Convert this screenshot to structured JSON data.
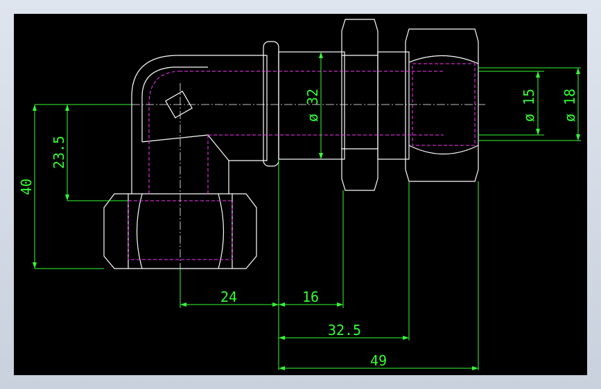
{
  "colors": {
    "background": "#000000",
    "outline": "#ffffff",
    "hidden": "#ff33ff",
    "dimension": "#33ff33",
    "frame": "#d4dbe6"
  },
  "dims": {
    "h40": "40",
    "h23_5": "23.5",
    "d32": "ø 32",
    "d15": "ø 15",
    "d18": "ø 18",
    "l24": "24",
    "l16": "16",
    "l32_5": "32.5",
    "l49": "49"
  }
}
